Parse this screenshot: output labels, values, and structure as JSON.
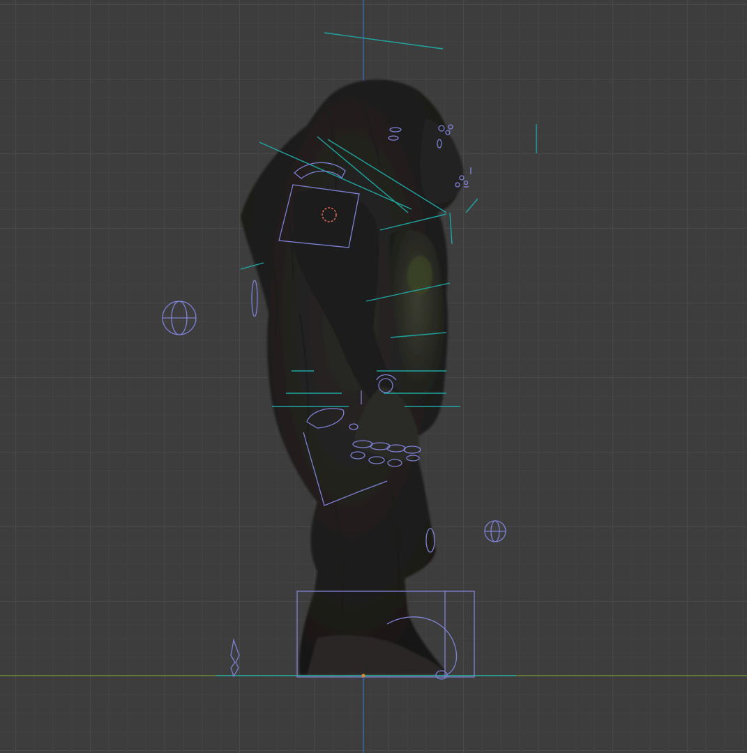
{
  "viewport": {
    "view": "right-orthographic",
    "background_color": "#3d3d3d",
    "grid_color": "#484848",
    "axis_colors": {
      "vertical": "#3b64b8",
      "horizontal": "#6f8a34"
    }
  },
  "scene": {
    "object": "gorilla-character",
    "rig_widget_color": "#7f82d6",
    "bone_line_color": "#1fa7a3",
    "active_control_color": "#e26a5a"
  }
}
